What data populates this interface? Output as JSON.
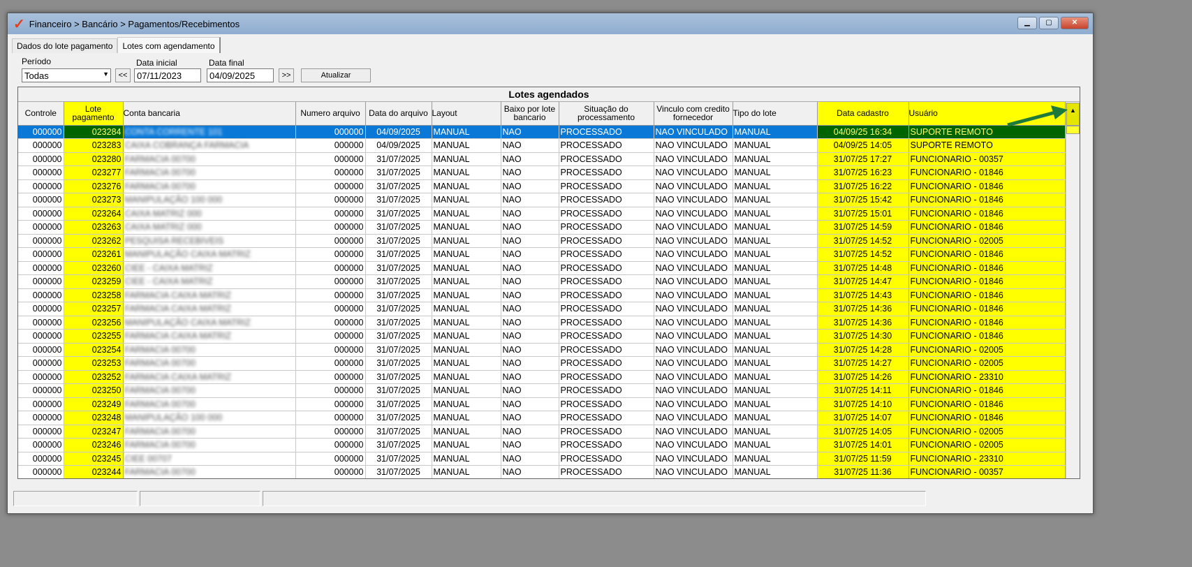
{
  "window": {
    "title": "Financeiro > Bancário > Pagamentos/Recebimentos",
    "logo": "V"
  },
  "tabs": [
    {
      "label": "Dados do lote pagamento"
    },
    {
      "label": "Lotes com agendamento"
    }
  ],
  "filters": {
    "periodo_label": "Período",
    "periodo_value": "Todas",
    "data_inicial_label": "Data inicial",
    "data_inicial": "07/11/2023",
    "data_final_label": "Data final",
    "data_final": "04/09/2025",
    "prev": "<<",
    "next": ">>",
    "atualizar": "Atualizar"
  },
  "grid": {
    "title": "Lotes agendados",
    "columns": [
      "Controle",
      "Lote pagamento",
      "Conta bancaria",
      "Numero arquivo",
      "Data do arquivo",
      "Layout",
      "Baixo por lote bancario",
      "Situação do processamento",
      "Vinculo com credito fornecedor",
      "Tipo do lote",
      "Data cadastro",
      "Usuário"
    ],
    "rows": [
      [
        "000000",
        "023284",
        "CONTA CORRENTE 101",
        "000000",
        "04/09/2025",
        "MANUAL",
        "NAO",
        "PROCESSADO",
        "NAO VINCULADO",
        "MANUAL",
        "04/09/25 16:34",
        "SUPORTE REMOTO"
      ],
      [
        "000000",
        "023283",
        "CAIXA COBRANÇA FARMACIA",
        "000000",
        "04/09/2025",
        "MANUAL",
        "NAO",
        "PROCESSADO",
        "NAO VINCULADO",
        "MANUAL",
        "04/09/25 14:05",
        "SUPORTE REMOTO"
      ],
      [
        "000000",
        "023280",
        "FARMACIA 00700",
        "000000",
        "31/07/2025",
        "MANUAL",
        "NAO",
        "PROCESSADO",
        "NAO VINCULADO",
        "MANUAL",
        "31/07/25 17:27",
        "FUNCIONARIO - 00357"
      ],
      [
        "000000",
        "023277",
        "FARMACIA 00700",
        "000000",
        "31/07/2025",
        "MANUAL",
        "NAO",
        "PROCESSADO",
        "NAO VINCULADO",
        "MANUAL",
        "31/07/25 16:23",
        "FUNCIONARIO - 01846"
      ],
      [
        "000000",
        "023276",
        "FARMACIA 00700",
        "000000",
        "31/07/2025",
        "MANUAL",
        "NAO",
        "PROCESSADO",
        "NAO VINCULADO",
        "MANUAL",
        "31/07/25 16:22",
        "FUNCIONARIO - 01846"
      ],
      [
        "000000",
        "023273",
        "MANIPULAÇÃO 100 000",
        "000000",
        "31/07/2025",
        "MANUAL",
        "NAO",
        "PROCESSADO",
        "NAO VINCULADO",
        "MANUAL",
        "31/07/25 15:42",
        "FUNCIONARIO - 01846"
      ],
      [
        "000000",
        "023264",
        "CAIXA MATRIZ 000",
        "000000",
        "31/07/2025",
        "MANUAL",
        "NAO",
        "PROCESSADO",
        "NAO VINCULADO",
        "MANUAL",
        "31/07/25 15:01",
        "FUNCIONARIO - 01846"
      ],
      [
        "000000",
        "023263",
        "CAIXA MATRIZ 000",
        "000000",
        "31/07/2025",
        "MANUAL",
        "NAO",
        "PROCESSADO",
        "NAO VINCULADO",
        "MANUAL",
        "31/07/25 14:59",
        "FUNCIONARIO - 01846"
      ],
      [
        "000000",
        "023262",
        "PESQUISA RECEBIVEIS",
        "000000",
        "31/07/2025",
        "MANUAL",
        "NAO",
        "PROCESSADO",
        "NAO VINCULADO",
        "MANUAL",
        "31/07/25 14:52",
        "FUNCIONARIO - 02005"
      ],
      [
        "000000",
        "023261",
        "MANIPULAÇÃO CAIXA MATRIZ",
        "000000",
        "31/07/2025",
        "MANUAL",
        "NAO",
        "PROCESSADO",
        "NAO VINCULADO",
        "MANUAL",
        "31/07/25 14:52",
        "FUNCIONARIO - 01846"
      ],
      [
        "000000",
        "023260",
        "CIEE - CAIXA MATRIZ",
        "000000",
        "31/07/2025",
        "MANUAL",
        "NAO",
        "PROCESSADO",
        "NAO VINCULADO",
        "MANUAL",
        "31/07/25 14:48",
        "FUNCIONARIO - 01846"
      ],
      [
        "000000",
        "023259",
        "CIEE - CAIXA MATRIZ",
        "000000",
        "31/07/2025",
        "MANUAL",
        "NAO",
        "PROCESSADO",
        "NAO VINCULADO",
        "MANUAL",
        "31/07/25 14:47",
        "FUNCIONARIO - 01846"
      ],
      [
        "000000",
        "023258",
        "FARMACIA CAIXA MATRIZ",
        "000000",
        "31/07/2025",
        "MANUAL",
        "NAO",
        "PROCESSADO",
        "NAO VINCULADO",
        "MANUAL",
        "31/07/25 14:43",
        "FUNCIONARIO - 01846"
      ],
      [
        "000000",
        "023257",
        "FARMACIA CAIXA MATRIZ",
        "000000",
        "31/07/2025",
        "MANUAL",
        "NAO",
        "PROCESSADO",
        "NAO VINCULADO",
        "MANUAL",
        "31/07/25 14:36",
        "FUNCIONARIO - 01846"
      ],
      [
        "000000",
        "023256",
        "MANIPULAÇÃO CAIXA MATRIZ",
        "000000",
        "31/07/2025",
        "MANUAL",
        "NAO",
        "PROCESSADO",
        "NAO VINCULADO",
        "MANUAL",
        "31/07/25 14:36",
        "FUNCIONARIO - 01846"
      ],
      [
        "000000",
        "023255",
        "FARMACIA CAIXA MATRIZ",
        "000000",
        "31/07/2025",
        "MANUAL",
        "NAO",
        "PROCESSADO",
        "NAO VINCULADO",
        "MANUAL",
        "31/07/25 14:30",
        "FUNCIONARIO - 01846"
      ],
      [
        "000000",
        "023254",
        "FARMACIA 00700",
        "000000",
        "31/07/2025",
        "MANUAL",
        "NAO",
        "PROCESSADO",
        "NAO VINCULADO",
        "MANUAL",
        "31/07/25 14:28",
        "FUNCIONARIO - 02005"
      ],
      [
        "000000",
        "023253",
        "FARMACIA 00700",
        "000000",
        "31/07/2025",
        "MANUAL",
        "NAO",
        "PROCESSADO",
        "NAO VINCULADO",
        "MANUAL",
        "31/07/25 14:27",
        "FUNCIONARIO - 02005"
      ],
      [
        "000000",
        "023252",
        "FARMACIA CAIXA MATRIZ",
        "000000",
        "31/07/2025",
        "MANUAL",
        "NAO",
        "PROCESSADO",
        "NAO VINCULADO",
        "MANUAL",
        "31/07/25 14:26",
        "FUNCIONARIO - 23310"
      ],
      [
        "000000",
        "023250",
        "FARMACIA 00700",
        "000000",
        "31/07/2025",
        "MANUAL",
        "NAO",
        "PROCESSADO",
        "NAO VINCULADO",
        "MANUAL",
        "31/07/25 14:11",
        "FUNCIONARIO - 01846"
      ],
      [
        "000000",
        "023249",
        "FARMACIA 00700",
        "000000",
        "31/07/2025",
        "MANUAL",
        "NAO",
        "PROCESSADO",
        "NAO VINCULADO",
        "MANUAL",
        "31/07/25 14:10",
        "FUNCIONARIO - 01846"
      ],
      [
        "000000",
        "023248",
        "MANIPULAÇÃO 100 000",
        "000000",
        "31/07/2025",
        "MANUAL",
        "NAO",
        "PROCESSADO",
        "NAO VINCULADO",
        "MANUAL",
        "31/07/25 14:07",
        "FUNCIONARIO - 01846"
      ],
      [
        "000000",
        "023247",
        "FARMACIA 00700",
        "000000",
        "31/07/2025",
        "MANUAL",
        "NAO",
        "PROCESSADO",
        "NAO VINCULADO",
        "MANUAL",
        "31/07/25 14:05",
        "FUNCIONARIO - 02005"
      ],
      [
        "000000",
        "023246",
        "FARMACIA 00700",
        "000000",
        "31/07/2025",
        "MANUAL",
        "NAO",
        "PROCESSADO",
        "NAO VINCULADO",
        "MANUAL",
        "31/07/25 14:01",
        "FUNCIONARIO - 02005"
      ],
      [
        "000000",
        "023245",
        "CIEE 00707",
        "000000",
        "31/07/2025",
        "MANUAL",
        "NAO",
        "PROCESSADO",
        "NAO VINCULADO",
        "MANUAL",
        "31/07/25 11:59",
        "FUNCIONARIO - 23310"
      ],
      [
        "000000",
        "023244",
        "FARMACIA 00700",
        "000000",
        "31/07/2025",
        "MANUAL",
        "NAO",
        "PROCESSADO",
        "NAO VINCULADO",
        "MANUAL",
        "31/07/25 11:36",
        "FUNCIONARIO - 00357"
      ]
    ]
  },
  "colors": {
    "highlight": "#ffff00",
    "selected": "#0a78d7",
    "selected_highlight": "#006400",
    "arrow": "#1e7a3c"
  }
}
